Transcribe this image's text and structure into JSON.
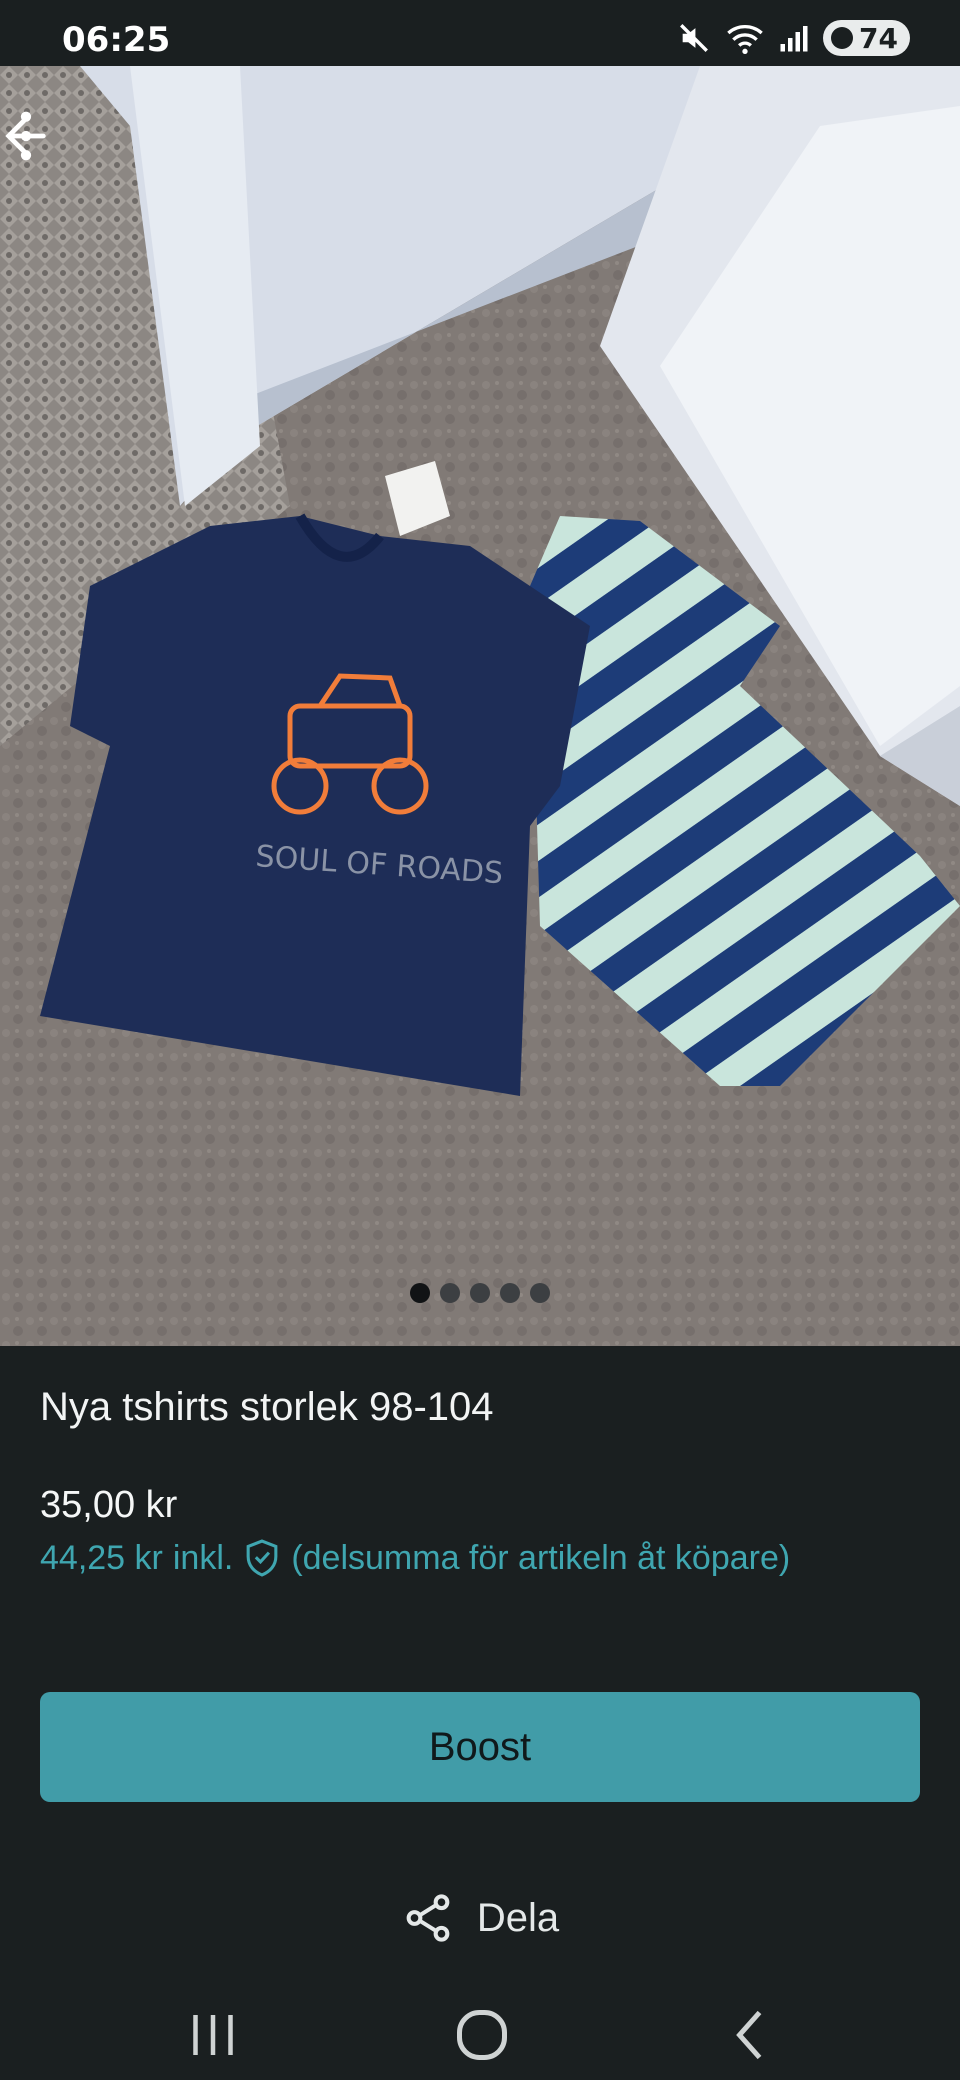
{
  "status": {
    "time": "06:25",
    "battery": "74"
  },
  "listing": {
    "title": "Nya tshirts storlek 98-104",
    "price": "35,00 kr",
    "price_incl_amount": "44,25 kr",
    "price_incl_label": "inkl.",
    "price_incl_note": "(delsumma för artikeln åt köpare)",
    "photo_count": 5,
    "current_photo": 1,
    "print_text": "SOUL OF ROADS"
  },
  "actions": {
    "boost_label": "Boost",
    "share_label": "Dela"
  },
  "colors": {
    "background": "#1a1f20",
    "accent": "#419ca8",
    "accent_text": "#3fa6b0"
  }
}
